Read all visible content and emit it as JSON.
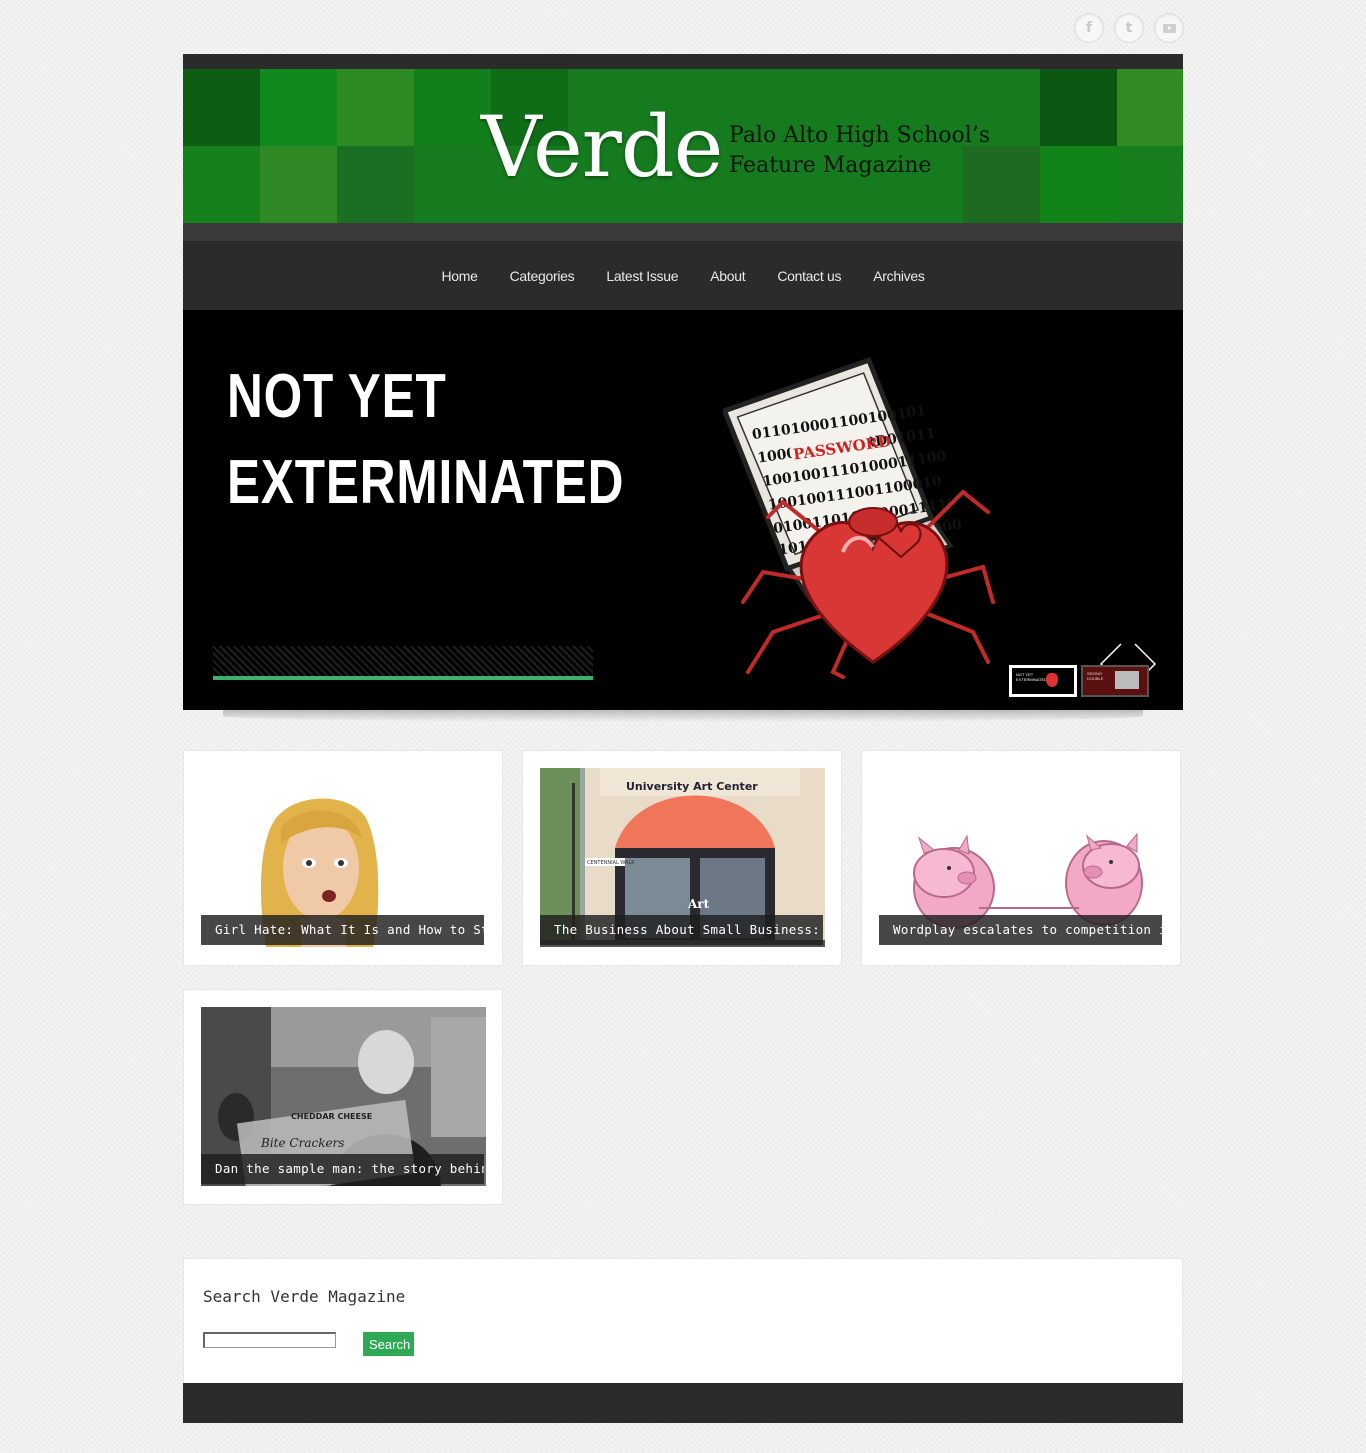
{
  "social": {
    "facebook_glyph": "f",
    "twitter_glyph": "t"
  },
  "header": {
    "logo": "Verde",
    "tagline_line1": "Palo Alto High School’s",
    "tagline_line2": "Feature Magazine"
  },
  "nav": {
    "items": [
      "Home",
      "Categories",
      "Latest Issue",
      "About",
      "Contact us",
      "Archives"
    ]
  },
  "slider": {
    "title_line1": "NOT YET",
    "title_line2": "EXTERMINATED",
    "art_text": {
      "binary_1": "011010001100100101",
      "binary_2": "1000PASSWORD01011",
      "binary_3": "1001001110100011100",
      "binary_4": "100100111001100010",
      "binary_5": "0100110111000011110",
      "binary_6": "1011001010111001000"
    },
    "thumb_active_text": "NOT YET EXTERMINATED",
    "thumb_other_text": "SEEING DOUBLE"
  },
  "posts": [
    {
      "caption": "Girl Hate: What It Is and How to Stop It"
    },
    {
      "caption": "The Business About Small Business: The",
      "sign": "University Art Center",
      "sign2": "Art",
      "street": "CENTENNIAL WALK"
    },
    {
      "caption": "Wordplay escalates to competition in"
    },
    {
      "caption": "Dan the sample man: the story behind the",
      "box_text1": "CHEDDAR CHEESE",
      "box_text2": "Bite Crackers"
    }
  ],
  "search": {
    "title": "Search Verde Magazine",
    "placeholder": "",
    "button": "Search"
  },
  "colors": {
    "accent": "#2eaa55",
    "dark": "#2b2b2b",
    "banner_green": "#167a1f"
  }
}
